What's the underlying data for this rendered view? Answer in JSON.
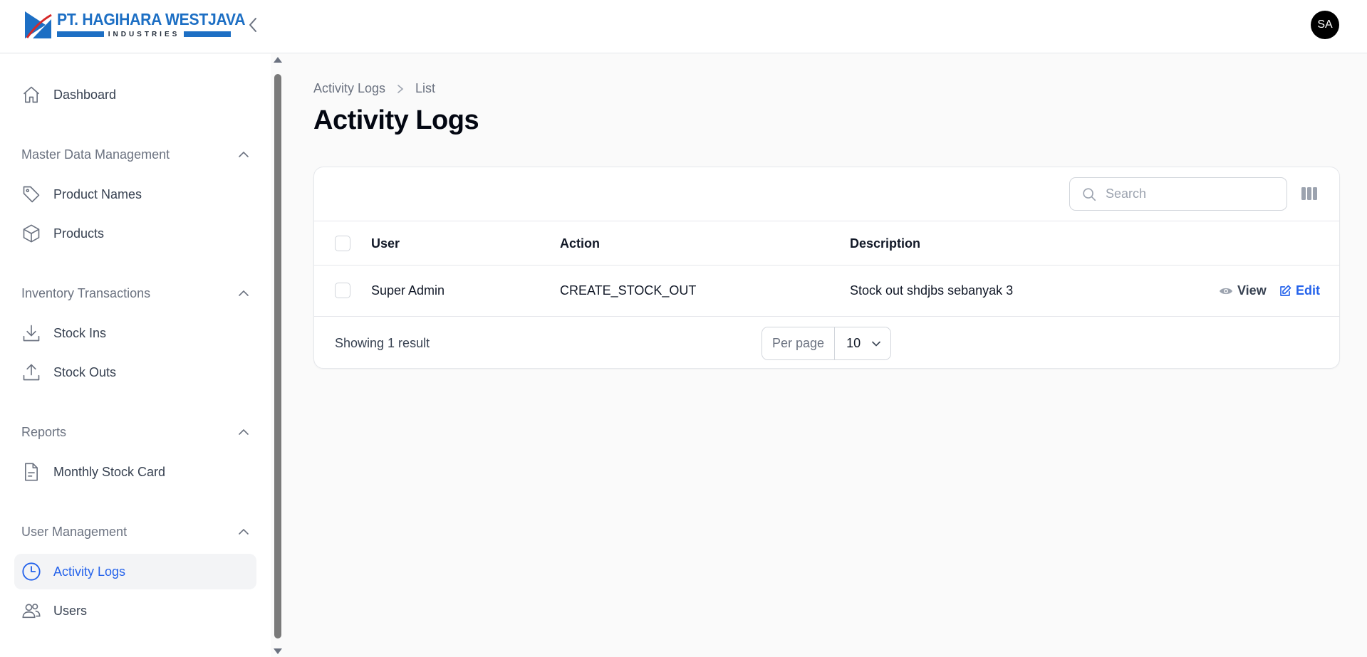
{
  "brand": {
    "name": "PT. HAGIHARA WESTJAVA",
    "sub": "INDUSTRIES",
    "color": "#1d6fc4"
  },
  "user": {
    "initials": "SA"
  },
  "sidebar": {
    "dashboard": "Dashboard",
    "groups": [
      {
        "title": "Master Data Management",
        "items": [
          "Product Names",
          "Products"
        ]
      },
      {
        "title": "Inventory Transactions",
        "items": [
          "Stock Ins",
          "Stock Outs"
        ]
      },
      {
        "title": "Reports",
        "items": [
          "Monthly Stock Card"
        ]
      },
      {
        "title": "User Management",
        "items": [
          "Activity Logs",
          "Users"
        ]
      }
    ],
    "active_item": "Activity Logs",
    "accent": "#2563eb"
  },
  "breadcrumb": [
    "Activity Logs",
    "List"
  ],
  "page_title": "Activity Logs",
  "table": {
    "search_placeholder": "Search",
    "columns": [
      "User",
      "Action",
      "Description"
    ],
    "rows": [
      {
        "user": "Super Admin",
        "action": "CREATE_STOCK_OUT",
        "description": "Stock out shdjbs sebanyak 3",
        "view_label": "View",
        "edit_label": "Edit"
      }
    ],
    "showing": "Showing 1 result",
    "per_page_label": "Per page",
    "per_page_value": "10"
  }
}
